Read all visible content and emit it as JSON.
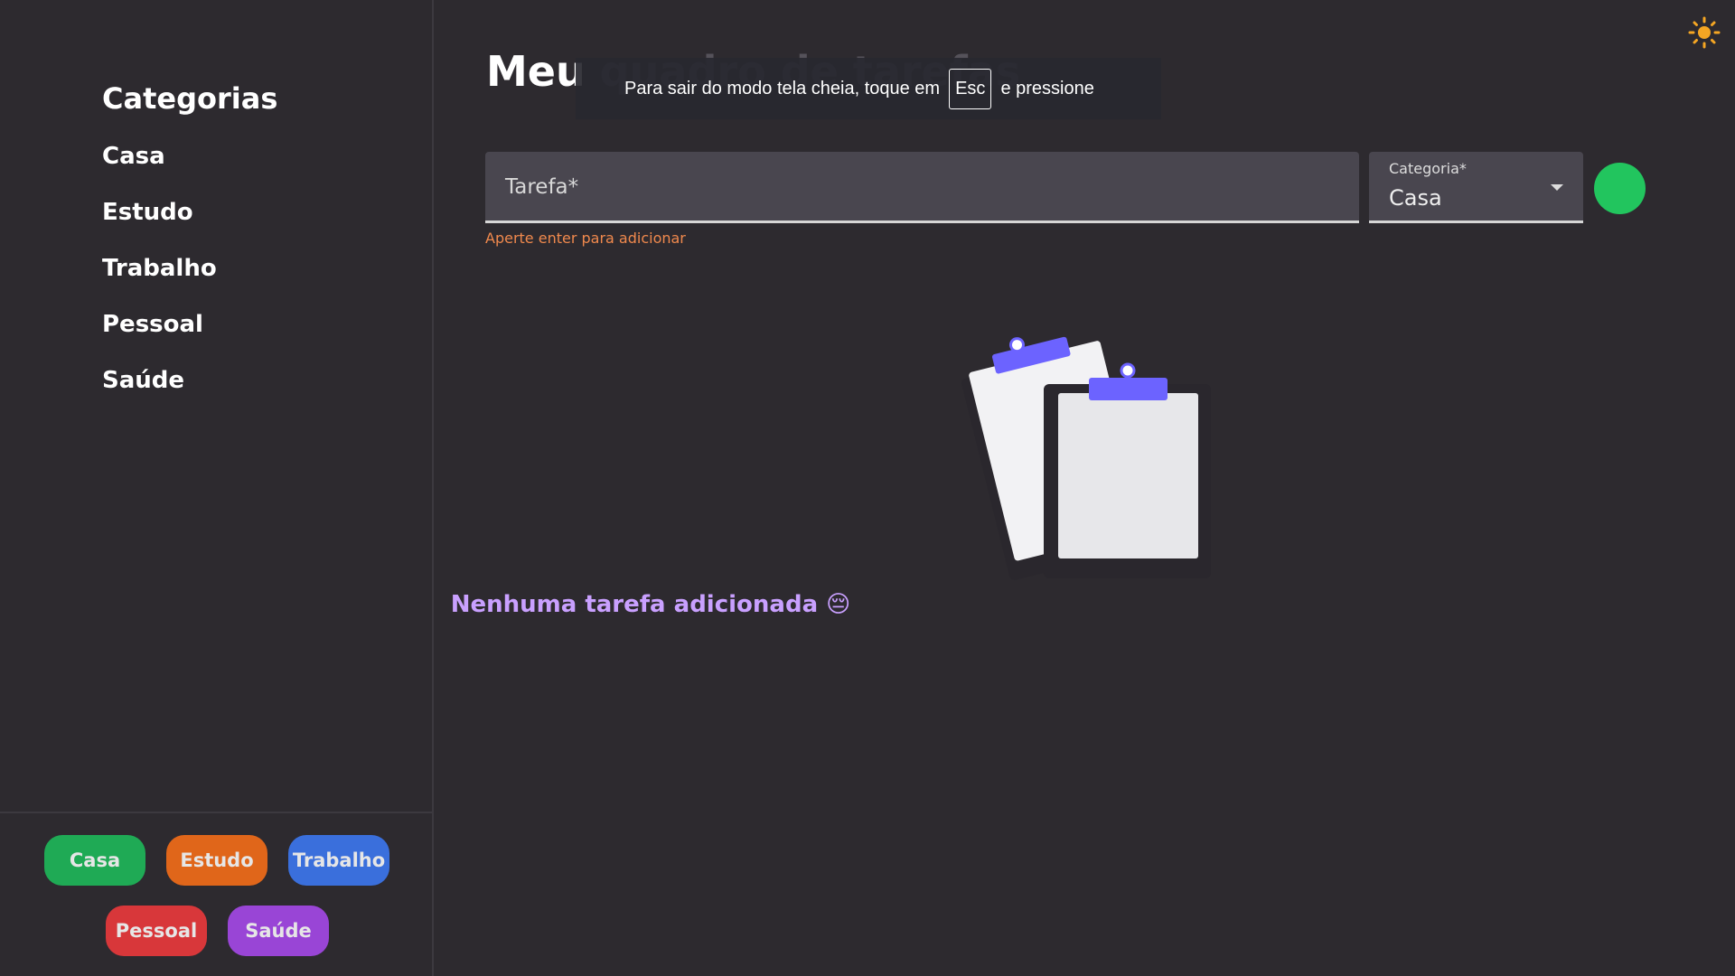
{
  "sidebar": {
    "title": "Categorias",
    "items": [
      "Casa",
      "Estudo",
      "Trabalho",
      "Pessoal",
      "Saúde"
    ]
  },
  "chips": [
    {
      "label": "Casa",
      "color": "#1faa55"
    },
    {
      "label": "Estudo",
      "color": "#e0661a"
    },
    {
      "label": "Trabalho",
      "color": "#3a6fdc"
    },
    {
      "label": "Pessoal",
      "color": "#d8373a"
    },
    {
      "label": "Saúde",
      "color": "#9945d6"
    }
  ],
  "header": {
    "title_first": "Meu",
    "title_rest": " quadro de tarefas"
  },
  "toast": {
    "before": "Para sair do modo tela cheia, toque em",
    "key": "Esc",
    "after": "e pressione"
  },
  "form": {
    "task_placeholder": "Tarefa*",
    "hint": "Aperte enter para adicionar",
    "category_label": "Categoria*",
    "category_value": "Casa"
  },
  "empty": {
    "message": "Nenhuma tarefa adicionada 😔"
  }
}
